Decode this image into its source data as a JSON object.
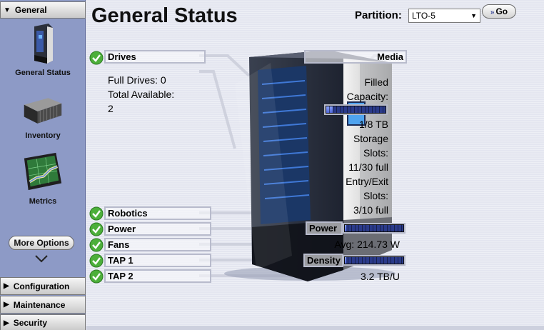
{
  "sidebar": {
    "general": "General",
    "items": {
      "status": "General Status",
      "inventory": "Inventory",
      "metrics": "Metrics"
    },
    "more_options": "More Options",
    "configuration": "Configuration",
    "maintenance": "Maintenance",
    "security": "Security"
  },
  "header": {
    "title": "General Status",
    "partition_label": "Partition:",
    "partition_value": "LTO-5",
    "go": "Go"
  },
  "status": {
    "drives": {
      "label": "Drives",
      "full": "Full Drives: 0",
      "total_label": "Total Available:",
      "total_value": "2"
    },
    "media": {
      "label": "Media",
      "filled_1": "Filled",
      "filled_2": "Capacity:",
      "filled_fraction": 0.125,
      "filled_value": "1/8 TB",
      "storage_1": "Storage",
      "storage_2": "Slots:",
      "storage_value": "11/30 full",
      "entry_1": "Entry/Exit",
      "entry_2": "Slots:",
      "entry_value": "3/10 full"
    },
    "robotics": "Robotics",
    "power_comp": "Power",
    "fans": "Fans",
    "tap1": "TAP 1",
    "tap2": "TAP 2",
    "power": {
      "label": "Power",
      "fraction": 0.05,
      "value": "Avg: 214.73 W"
    },
    "density": {
      "label": "Density",
      "fraction": 0.05,
      "value": "3.2 TB/U"
    }
  },
  "colors": {
    "sidebar": "#8d9ac6",
    "main_bg": "#e4e6f0",
    "meter_bg": "#2a3a8a",
    "ok_green": "#4caf3a"
  },
  "icons": {
    "ok": "check-circle-icon",
    "status": "library-tower-icon",
    "inventory": "tape-cartridges-icon",
    "metrics": "chart-monitor-icon"
  }
}
